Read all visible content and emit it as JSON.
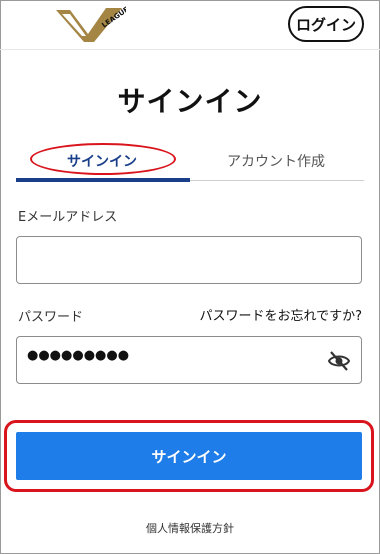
{
  "header": {
    "logo_text": "LEAGUE",
    "login_label": "ログイン"
  },
  "page_title": "サインイン",
  "tabs": [
    {
      "label": "サインイン",
      "active": true
    },
    {
      "label": "アカウント作成",
      "active": false
    }
  ],
  "form": {
    "email_label": "Eメールアドレス",
    "email_value": "",
    "password_label": "パスワード",
    "forgot_label": "パスワードをお忘れですか?",
    "password_value": "●●●●●●●●●"
  },
  "submit_label": "サインイン",
  "footer": {
    "privacy_label": "個人情報保護方針"
  },
  "colors": {
    "accent_blue": "#1e7de8",
    "tab_active": "#1a3f8a",
    "annotation_red": "#d9141c",
    "logo_gold": "#a48544"
  },
  "icons": {
    "logo": "v-league-logo",
    "password_toggle": "eye-slash-icon"
  }
}
